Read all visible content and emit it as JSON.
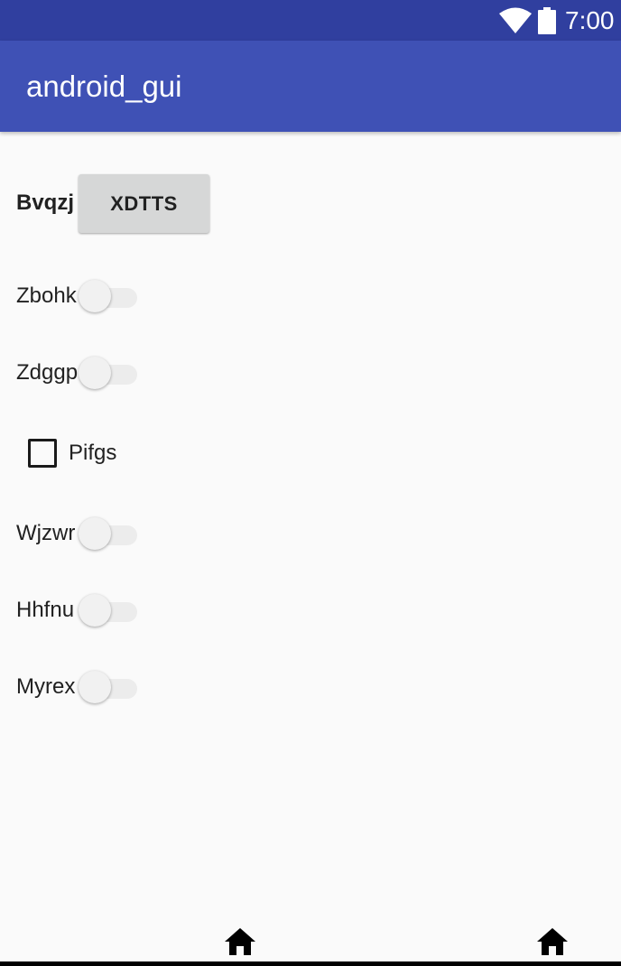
{
  "status_bar": {
    "time": "7:00",
    "icons": [
      "wifi-icon",
      "battery-icon"
    ]
  },
  "app_bar": {
    "title": "android_gui"
  },
  "content": {
    "button_row": {
      "label": "Bvqzj",
      "button_label": "XDTTS"
    },
    "switches": [
      {
        "label": "Zbohk",
        "checked": false
      },
      {
        "label": "Zdggp",
        "checked": false
      },
      {
        "label": "Wjzwr",
        "checked": false
      },
      {
        "label": "Hhfnu",
        "checked": false
      },
      {
        "label": "Myrex",
        "checked": false
      }
    ],
    "checkbox": {
      "label": "Pifgs",
      "checked": false
    }
  },
  "nav_bar": {
    "icons": [
      "home-icon",
      "home-icon"
    ]
  },
  "colors": {
    "status_bar": "#303F9F",
    "app_bar": "#3F51B5",
    "background": "#FAFAFA",
    "button": "#D6D7D7"
  }
}
